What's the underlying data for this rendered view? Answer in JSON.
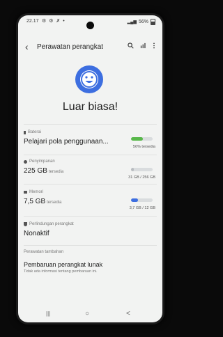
{
  "status": {
    "time": "22.17",
    "icons": "⚙ ⚙ ✗ •",
    "battery": "56%"
  },
  "header": {
    "title": "Perawatan perangkat"
  },
  "summary": {
    "headline": "Luar biasa!"
  },
  "battery": {
    "label": "Baterai",
    "text": "Pelajari pola penggunaan...",
    "amount": "56% tersedia",
    "level": 0.56,
    "color": "#58b84a"
  },
  "storage": {
    "label": "Penyimpanan",
    "value": "225 GB",
    "unit": "tersedia",
    "amount": "31 GB / 256 GB",
    "level": 0.12,
    "color": "#b8bcc0"
  },
  "memory": {
    "label": "Memori",
    "value": "7,5 GB",
    "unit": "tersedia",
    "amount": "3,7 GB / 12 GB",
    "level": 0.31,
    "color": "#3d6ee0"
  },
  "device_protection": {
    "label": "Perlindungan perangkat",
    "value": "Nonaktif"
  },
  "additional": {
    "section": "Perawatan tambahan",
    "title": "Pembaruan perangkat lunak",
    "subtitle": "Tidak ada informasi tentang pembaruan ini."
  },
  "navbar": {
    "recents": "|||",
    "home": "○",
    "back": "<"
  },
  "icons": {
    "back": "back-arrow-icon",
    "search": "search-icon",
    "stats": "stats-icon",
    "more": "more-options-icon",
    "face": "smiley-face-icon",
    "recents": "recent-apps-icon",
    "home": "home-icon",
    "nav_back": "nav-back-icon"
  },
  "accent": "#3d6ee0"
}
